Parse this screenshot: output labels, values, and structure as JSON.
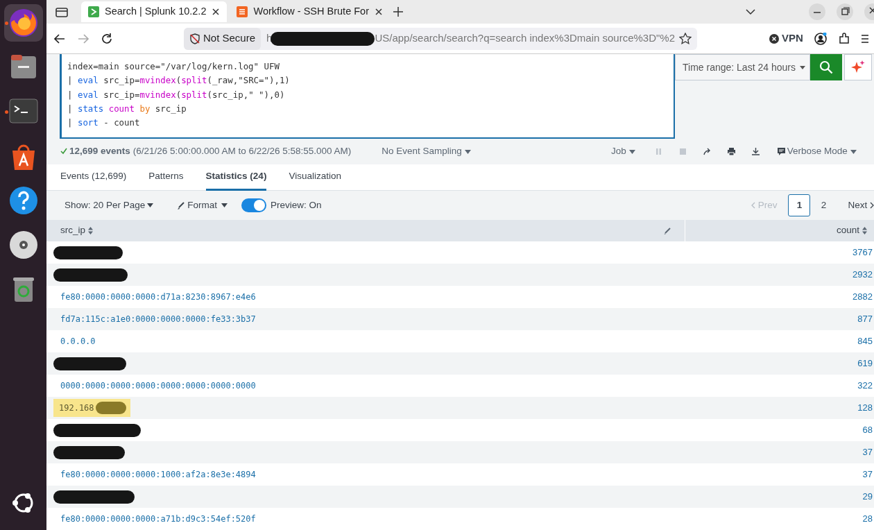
{
  "dock": {
    "items": [
      {
        "kind": "firefox",
        "running": true
      },
      {
        "kind": "files",
        "running": false
      },
      {
        "kind": "terminal",
        "running": true
      },
      {
        "kind": "appcenter",
        "running": false
      },
      {
        "kind": "help",
        "running": false
      },
      {
        "kind": "disc",
        "running": false
      },
      {
        "kind": "trash",
        "running": false
      }
    ],
    "bottom": {
      "kind": "ubuntu"
    }
  },
  "browser": {
    "tabs": [
      {
        "title": "Search | Splunk 10.2.2",
        "selected": true,
        "kind": "splunk"
      },
      {
        "title": "Workflow - SSH Brute For",
        "selected": false,
        "kind": "workflow"
      }
    ],
    "security": "Not Secure",
    "url_start": "h",
    "url_end": "US/app/search/search?q=search index%3Dmain source%3D\"%2",
    "vpn": "VPN"
  },
  "search": {
    "query_lines": [
      [
        {
          "text": "index=main source=\"/var/log/kern.log\" UFW",
          "kind": "plain"
        }
      ],
      [
        {
          "text": "| ",
          "kind": "plain"
        },
        {
          "text": "eval",
          "kind": "command"
        },
        {
          "text": " src_ip=",
          "kind": "plain"
        },
        {
          "text": "mvindex",
          "kind": "function"
        },
        {
          "text": "(",
          "kind": "plain"
        },
        {
          "text": "split",
          "kind": "function"
        },
        {
          "text": "(_raw,\"SRC=\"),1)",
          "kind": "plain"
        }
      ],
      [
        {
          "text": "| ",
          "kind": "plain"
        },
        {
          "text": "eval",
          "kind": "command"
        },
        {
          "text": " src_ip=",
          "kind": "plain"
        },
        {
          "text": "mvindex",
          "kind": "function"
        },
        {
          "text": "(",
          "kind": "plain"
        },
        {
          "text": "split",
          "kind": "function"
        },
        {
          "text": "(src_ip,\" \"),0)",
          "kind": "plain"
        }
      ],
      [
        {
          "text": "| ",
          "kind": "plain"
        },
        {
          "text": "stats",
          "kind": "command"
        },
        {
          "text": " count",
          "kind": "function"
        },
        {
          "text": " by",
          "kind": "keyword"
        },
        {
          "text": " src_ip",
          "kind": "plain"
        }
      ],
      [
        {
          "text": "| ",
          "kind": "plain"
        },
        {
          "text": "sort",
          "kind": "command"
        },
        {
          "text": " - count",
          "kind": "plain"
        }
      ]
    ],
    "time_range": "Time range: Last 24 hours"
  },
  "status": {
    "count": "12,699 events",
    "range": "(6/21/26 5:00:00.000 AM to 6/22/26 5:58:55.000 AM)",
    "sampling": "No Event Sampling",
    "job": "Job",
    "mode": "Verbose Mode"
  },
  "result_tabs": [
    {
      "label": "Events (12,699)",
      "selected": false
    },
    {
      "label": "Patterns",
      "selected": false
    },
    {
      "label": "Statistics (24)",
      "selected": true
    },
    {
      "label": "Visualization",
      "selected": false
    }
  ],
  "toolbar": {
    "show": "Show: 20 Per Page",
    "format": "Format",
    "preview": {
      "label": "Preview: On",
      "on": true
    }
  },
  "pagination": {
    "prev": "Prev",
    "pages": [
      {
        "label": "1",
        "selected": true
      },
      {
        "label": "2",
        "selected": false
      }
    ],
    "next": "Next"
  },
  "table": {
    "columns": [
      "src_ip",
      "count"
    ],
    "rows": [
      {
        "redacted": true,
        "count": "3767"
      },
      {
        "redacted": true,
        "count": "2932"
      },
      {
        "src_ip": "fe80:0000:0000:0000:d71a:8230:8967:e4e6",
        "count": "2882"
      },
      {
        "src_ip": "fd7a:115c:a1e0:0000:0000:0000:fe33:3b37",
        "count": "877"
      },
      {
        "src_ip": "0.0.0.0",
        "count": "845"
      },
      {
        "redacted": true,
        "count": "619"
      },
      {
        "src_ip": "0000:0000:0000:0000:0000:0000:0000:0000",
        "count": "322"
      },
      {
        "src_ip": "192.168",
        "redacted": true,
        "highlighted": true,
        "count": "128"
      },
      {
        "redacted": true,
        "count": "68"
      },
      {
        "redacted": true,
        "count": "37"
      },
      {
        "src_ip": "fe80:0000:0000:0000:1000:af2a:8e3e:4894",
        "count": "37"
      },
      {
        "redacted": true,
        "count": "29"
      },
      {
        "src_ip": "fe80:0000:0000:0000:a71b:d9c3:54ef:520f",
        "count": "28"
      }
    ]
  }
}
